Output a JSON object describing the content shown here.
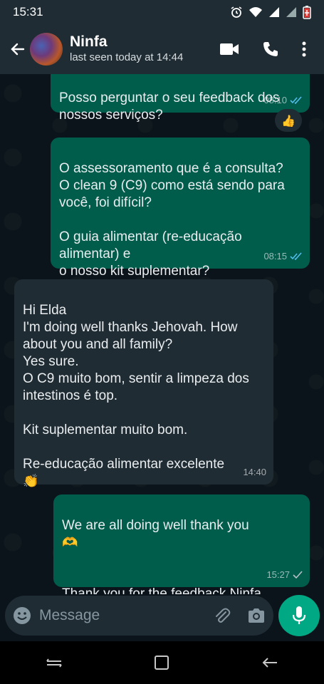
{
  "statusbar": {
    "time": "15:31"
  },
  "header": {
    "name": "Ninfa",
    "status": "last seen today at 14:44"
  },
  "messages": [
    {
      "dir": "out",
      "text": "Posso perguntar o seu feedback dos\nnossos serviços?",
      "time": "08:10"
    },
    {
      "dir": "out",
      "text": "O assessoramento que é a consulta?\nO clean 9 (C9) como está sendo para\nvocê, foi difícil?\n\nO guia alimentar (re-educação\nalimentar) e\no nosso kit suplementar?",
      "time": "08:15"
    },
    {
      "dir": "in",
      "text": "Hi Elda\nI'm doing well thanks Jehovah.  How\nabout you and all family?\nYes sure.\nO C9 muito bom, sentir a limpeza dos\nintestinos é top.\n\nKit suplementar muito bom.\n\nRe-educação alimentar excelente",
      "emoji": "👏",
      "time": "14:40"
    },
    {
      "dir": "out",
      "text": "We are all doing well thank you",
      "emoji": "🫶",
      "text2": "Thank you for the feedback Ninfa",
      "emoji2": "✊",
      "time": "15:27"
    }
  ],
  "reaction": "👍",
  "composer": {
    "placeholder": "Message"
  },
  "colors": {
    "outgoing": "#005c4b",
    "incoming": "#202c33",
    "accent": "#00a884",
    "ticks_read": "#53bdeb"
  }
}
